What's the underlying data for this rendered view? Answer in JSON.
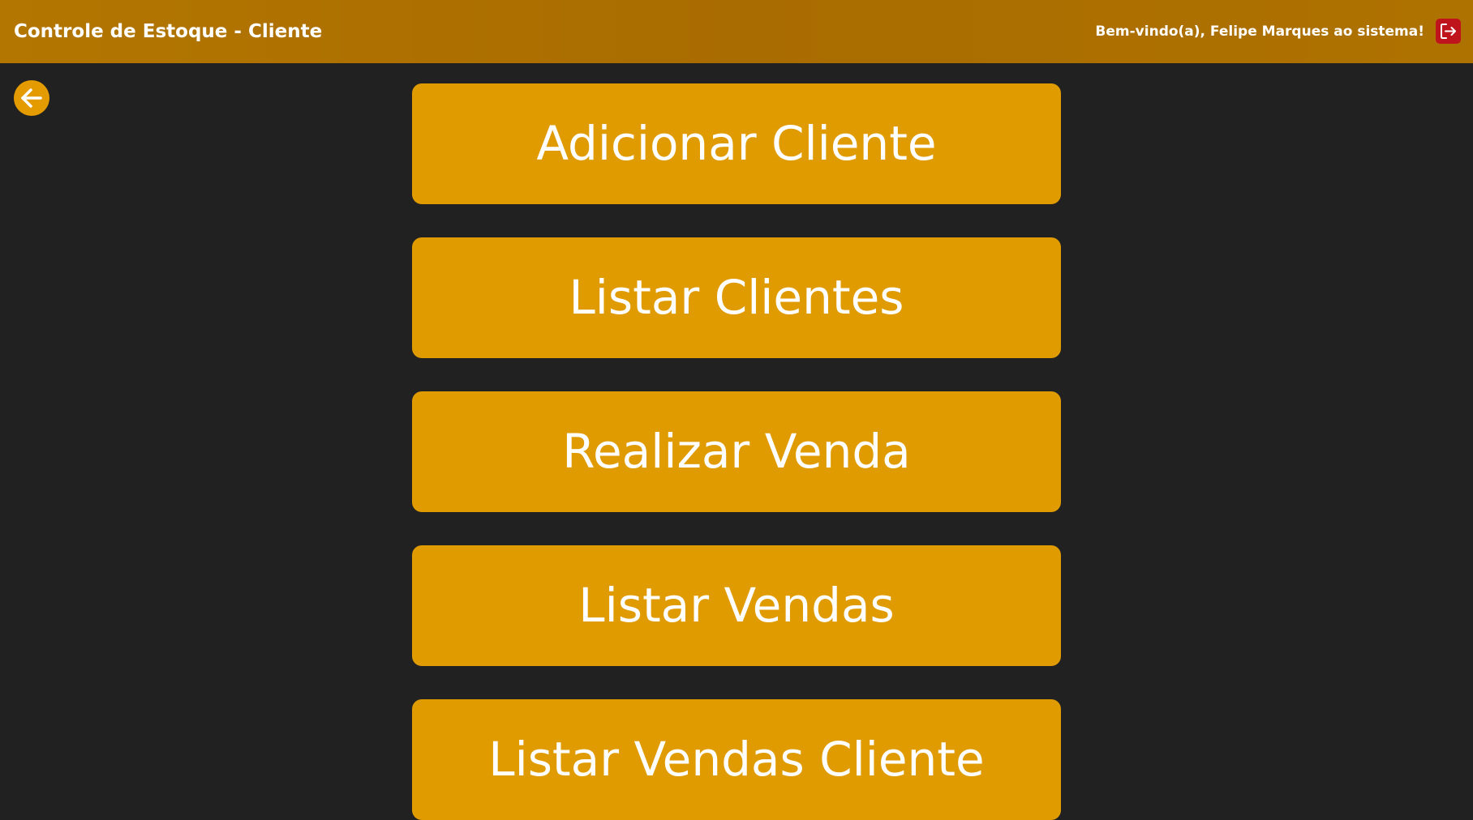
{
  "header": {
    "title": "Controle de Estoque - Cliente",
    "welcome": "Bem-vindo(a), Felipe Marques ao sistema!",
    "logout_icon": "logout-icon"
  },
  "nav": {
    "back_icon": "arrow-left-icon"
  },
  "menu": {
    "buttons": [
      {
        "label": "Adicionar Cliente"
      },
      {
        "label": "Listar Clientes"
      },
      {
        "label": "Realizar Venda"
      },
      {
        "label": "Listar Vendas"
      },
      {
        "label": "Listar Vendas Cliente"
      }
    ]
  },
  "colors": {
    "header_bg": "#ac6f00",
    "page_bg": "#212121",
    "button_bg": "#e09b00",
    "logout_bg": "#c0141c",
    "text": "#ffffff"
  }
}
